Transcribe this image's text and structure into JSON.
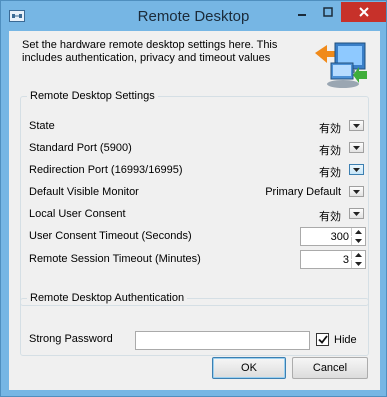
{
  "window": {
    "title": "Remote Desktop",
    "controls": {
      "minimize": "minimize-icon",
      "maximize": "maximize-icon",
      "close": "close-icon"
    }
  },
  "intro": {
    "line1": "Set the hardware remote desktop settings here. This",
    "line2": "includes authentication, privacy and timeout values"
  },
  "settings_group": {
    "title": "Remote Desktop Settings",
    "rows": [
      {
        "label": "State",
        "value": "有効"
      },
      {
        "label": "Standard Port (5900)",
        "value": "有効"
      },
      {
        "label": "Redirection Port (16993/16995)",
        "value": "有効"
      },
      {
        "label": "Default Visible Monitor",
        "value": "Primary Default"
      },
      {
        "label": "Local User Consent",
        "value": "有効"
      },
      {
        "label": "User Consent Timeout (Seconds)",
        "value": "300"
      },
      {
        "label": "Remote Session Timeout (Minutes)",
        "value": "3"
      }
    ]
  },
  "auth_group": {
    "title": "Remote Desktop Authentication",
    "password_label": "Strong Password",
    "password_value": "",
    "hide_label": "Hide",
    "hide_checked": true
  },
  "buttons": {
    "ok": "OK",
    "cancel": "Cancel"
  },
  "colors": {
    "titlebar": "#76b6e4",
    "close_button": "#c7312a",
    "accent": "#3c7fb1"
  }
}
